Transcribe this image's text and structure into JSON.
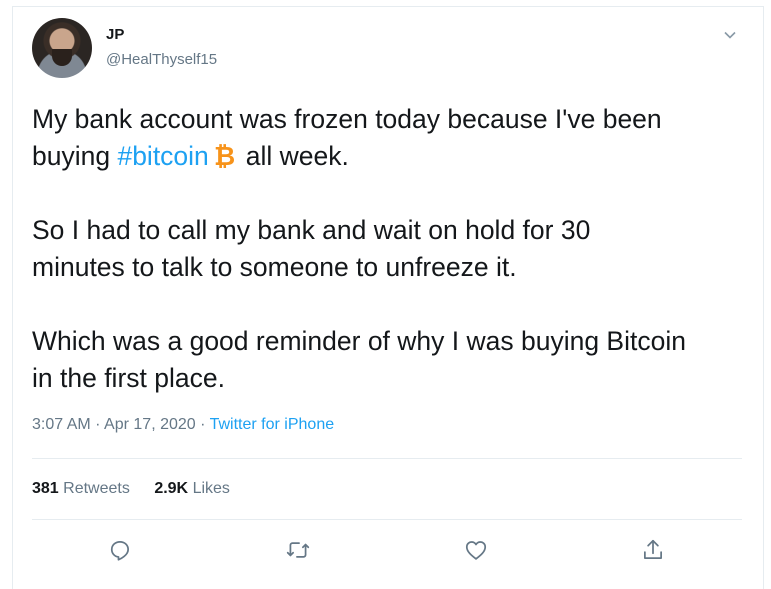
{
  "user": {
    "name": "JP",
    "handle": "@HealThyself15"
  },
  "tweet": {
    "line1": "My bank account was frozen today because I've been",
    "line2_before": "buying ",
    "hashtag": "#bitcoin",
    "line2_after": "all week.",
    "para2_line1": "So I had to call my bank and wait on hold for 30",
    "para2_line2": "minutes to talk to someone to unfreeze it.",
    "para3_line1": "Which was a good reminder of why I was buying Bitcoin",
    "para3_line2": "in the first place."
  },
  "meta": {
    "time": "3:07 AM",
    "sep1": " · ",
    "date": "Apr 17, 2020",
    "sep2": " · ",
    "source": "Twitter for iPhone"
  },
  "stats": {
    "retweets_count": "381",
    "retweets_label": "Retweets",
    "likes_count": "2.9K",
    "likes_label": "Likes"
  },
  "icons": {
    "caret": "chevron-down-icon",
    "bitcoin": "bitcoin-icon",
    "reply": "reply-icon",
    "retweet": "retweet-icon",
    "like": "heart-icon",
    "share": "share-icon"
  },
  "colors": {
    "link": "#1da1f2",
    "bitcoin": "#f7931a",
    "text": "#14171a",
    "secondary": "#657786",
    "border": "#e6ecf0"
  }
}
